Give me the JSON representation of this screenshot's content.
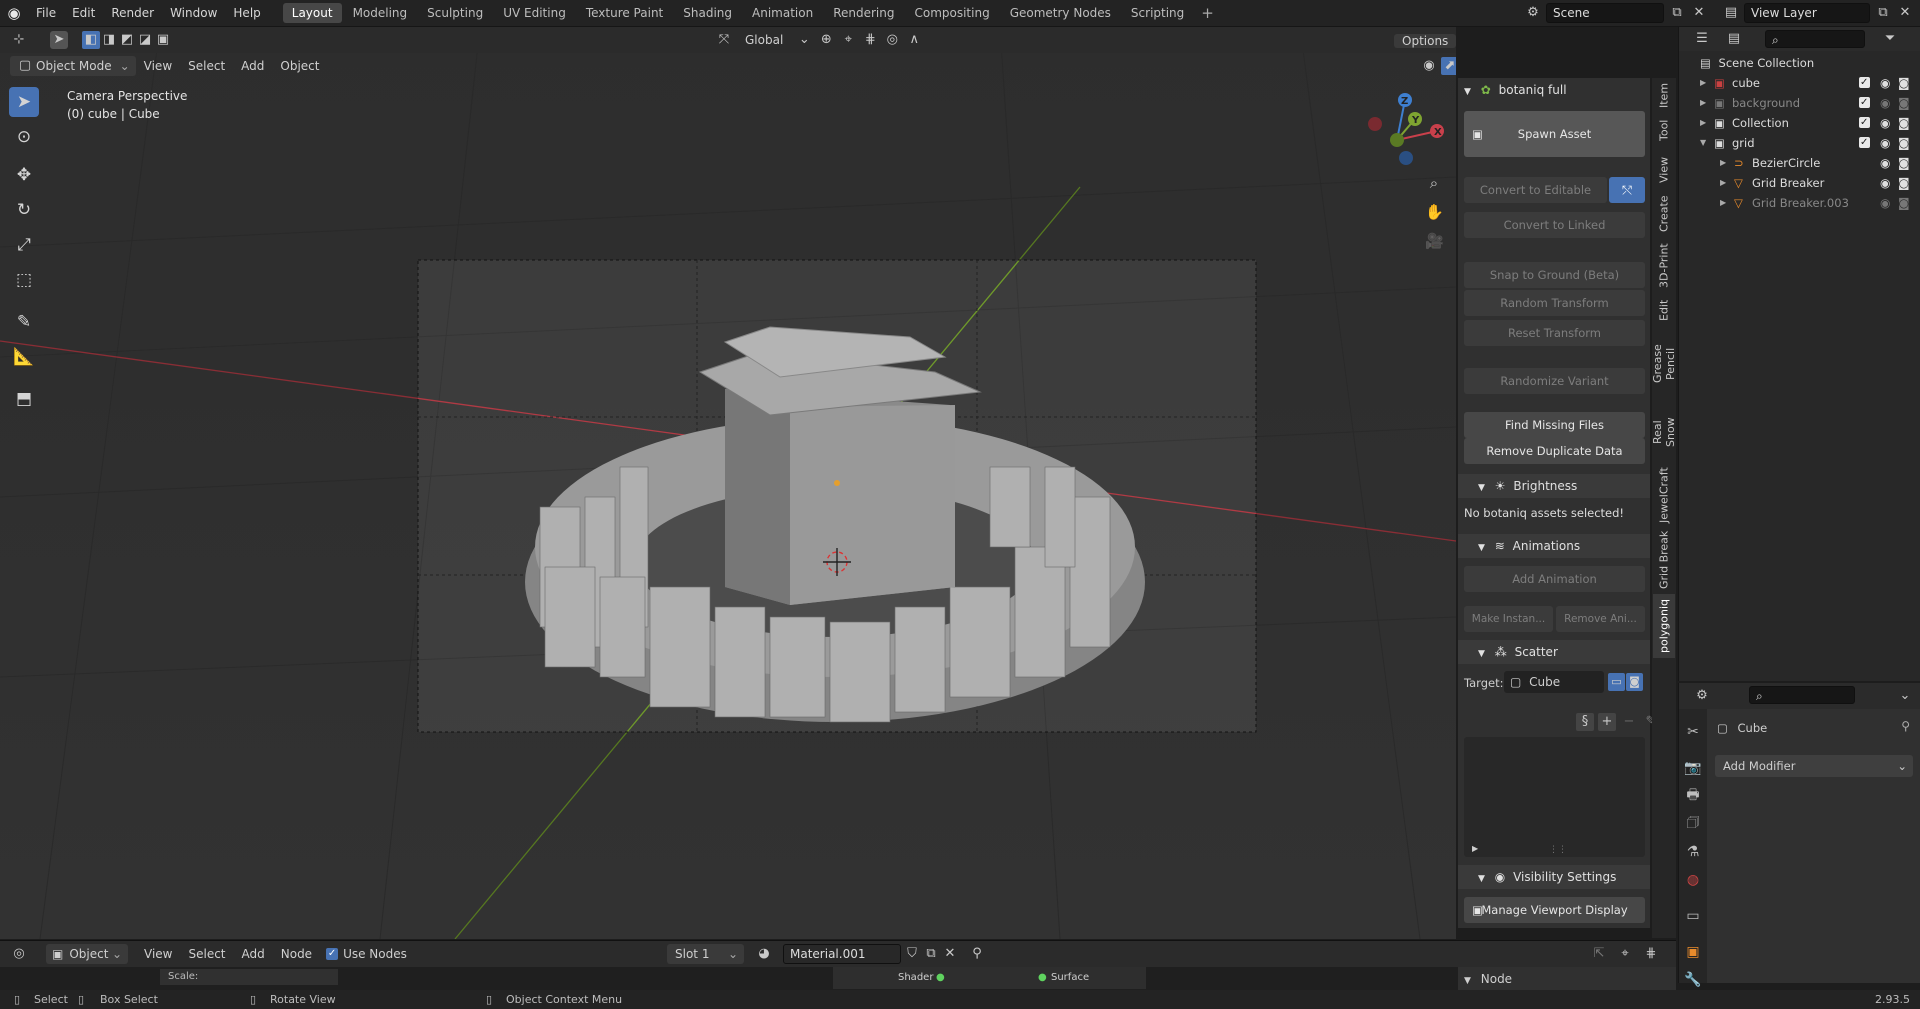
{
  "menu": {
    "file": "File",
    "edit": "Edit",
    "render": "Render",
    "window": "Window",
    "help": "Help"
  },
  "workspaces": [
    "Layout",
    "Modeling",
    "Sculpting",
    "UV Editing",
    "Texture Paint",
    "Shading",
    "Animation",
    "Rendering",
    "Compositing",
    "Geometry Nodes",
    "Scripting"
  ],
  "active_workspace": "Layout",
  "scene_name": "Scene",
  "view_layer": "View Layer",
  "header": {
    "mode": "Object Mode",
    "view": "View",
    "select": "Select",
    "add": "Add",
    "object": "Object",
    "orientation": "Global",
    "options": "Options"
  },
  "viewport": {
    "line1": "Camera Perspective",
    "line2": "(0) cube | Cube"
  },
  "npanel": {
    "addon_title": "botaniq full",
    "spawn": "Spawn Asset",
    "convert_editable": "Convert to Editable",
    "convert_linked": "Convert to Linked",
    "snap": "Snap to Ground (Beta)",
    "random_transform": "Random Transform",
    "reset_transform": "Reset Transform",
    "randomize_variant": "Randomize Variant",
    "find_missing": "Find Missing Files",
    "remove_dup": "Remove Duplicate Data",
    "brightness": "Brightness",
    "no_assets": "No botaniq assets selected!",
    "animations": "Animations",
    "add_animation": "Add Animation",
    "make_instance": "Make Instan...",
    "remove_anim": "Remove Ani...",
    "scatter": "Scatter",
    "target_label": "Target:",
    "target_value": "Cube",
    "visibility": "Visibility Settings",
    "manage_display": "Manage Viewport Display"
  },
  "vtabs": [
    "Item",
    "Tool",
    "View",
    "Create",
    "3D-Print",
    "Edit",
    "Grease Pencil",
    "Real Snow",
    "JewelCraft",
    "Grid Break",
    "polygoniq"
  ],
  "outliner": {
    "title": "Scene Collection",
    "rows": [
      {
        "name": "cube",
        "indent": 0
      },
      {
        "name": "background",
        "indent": 0
      },
      {
        "name": "Collection",
        "indent": 0
      },
      {
        "name": "grid",
        "indent": 0
      },
      {
        "name": "BezierCircle",
        "indent": 1
      },
      {
        "name": "Grid Breaker",
        "indent": 1
      },
      {
        "name": "Grid Breaker.003",
        "indent": 1
      }
    ]
  },
  "properties": {
    "object_name": "Cube",
    "add_modifier": "Add Modifier"
  },
  "node_header": {
    "object": "Object",
    "view": "View",
    "select": "Select",
    "add": "Add",
    "node": "Node",
    "use_nodes": "Use Nodes",
    "slot": "Slot 1",
    "material": "Material.001"
  },
  "node_editor": {
    "scale": "Scale:",
    "shader": "Shader",
    "surface": "Surface",
    "node_panel": "Node"
  },
  "status": {
    "select": "Select",
    "box_select": "Box Select",
    "rotate_view": "Rotate View",
    "context_menu": "Object Context Menu",
    "version": "2.93.5"
  },
  "colors": {
    "accent": "#4772b3",
    "x_axis": "#c9404b",
    "y_axis": "#7fa431",
    "z_axis": "#3e7fd0"
  }
}
